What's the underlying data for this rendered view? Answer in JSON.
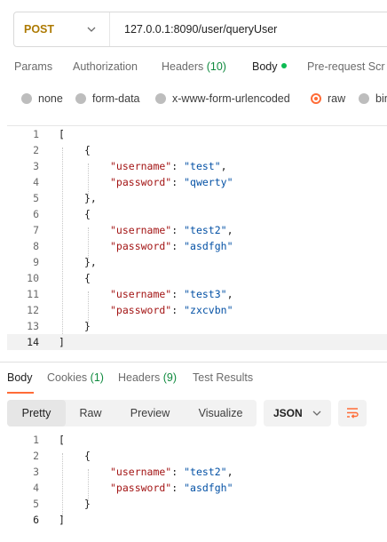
{
  "request": {
    "method": "POST",
    "url": "127.0.0.1:8090/user/queryUser"
  },
  "request_tabs": {
    "params": "Params",
    "authorization": "Authorization",
    "headers_label": "Headers",
    "headers_count": "(10)",
    "body": "Body",
    "prerequest": "Pre-request Scr"
  },
  "body_types": {
    "none": "none",
    "form_data": "form-data",
    "urlencoded": "x-www-form-urlencoded",
    "raw": "raw",
    "binary": "bin",
    "selected": "raw"
  },
  "editor": {
    "line_numbers": [
      "1",
      "2",
      "3",
      "4",
      "5",
      "6",
      "7",
      "8",
      "9",
      "10",
      "11",
      "12",
      "13",
      "14"
    ],
    "lines": {
      "l1": "[",
      "l2": "{",
      "l3_key": "\"username\"",
      "l3_sep": ": ",
      "l3_val": "\"test\"",
      "l3_end": ",",
      "l4_key": "\"password\"",
      "l4_sep": ": ",
      "l4_val": "\"qwerty\"",
      "l5": "},",
      "l6": "{",
      "l7_key": "\"username\"",
      "l7_sep": ": ",
      "l7_val": "\"test2\"",
      "l7_end": ",",
      "l8_key": "\"password\"",
      "l8_sep": ": ",
      "l8_val": "\"asdfgh\"",
      "l9": "},",
      "l10": "{",
      "l11_key": "\"username\"",
      "l11_sep": ": ",
      "l11_val": "\"test3\"",
      "l11_end": ",",
      "l12_key": "\"password\"",
      "l12_sep": ": ",
      "l12_val": "\"zxcvbn\"",
      "l13": "}",
      "l14": "]"
    }
  },
  "response_tabs": {
    "body": "Body",
    "cookies_label": "Cookies",
    "cookies_count": "(1)",
    "headers_label": "Headers",
    "headers_count": "(9)",
    "test_results": "Test Results"
  },
  "response_view": {
    "pretty": "Pretty",
    "raw": "Raw",
    "preview": "Preview",
    "visualize": "Visualize",
    "format": "JSON",
    "selected": "Pretty"
  },
  "response": {
    "line_numbers": [
      "1",
      "2",
      "3",
      "4",
      "5",
      "6"
    ],
    "l1": "[",
    "l2": "{",
    "l3_key": "\"username\"",
    "l3_sep": ": ",
    "l3_val": "\"test2\"",
    "l3_end": ",",
    "l4_key": "\"password\"",
    "l4_sep": ": ",
    "l4_val": "\"asdfgh\"",
    "l5": "}",
    "l6": "]"
  },
  "colors": {
    "accent": "#ff6c37",
    "method": "#ad7a03",
    "json_key": "#a31515",
    "json_string": "#0451a5",
    "count_green": "#0f8a3e"
  },
  "icons": [
    "chevron-down-icon",
    "wrap-lines-icon"
  ]
}
